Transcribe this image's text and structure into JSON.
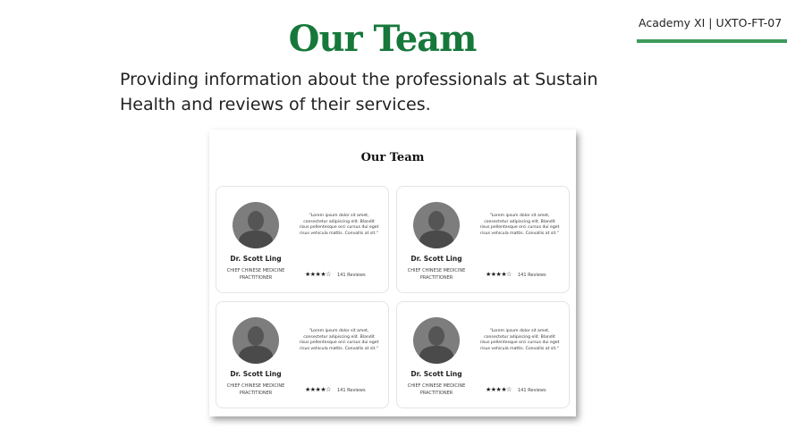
{
  "header": {
    "corner_label": "Academy XI | UXTO-FT-07",
    "accent_color": "#3d9a5b",
    "title": "Our Team",
    "title_color": "#16783a",
    "subtitle": "Providing information about the professionals at Sustain Health and reviews of their services."
  },
  "mockup": {
    "title": "Our Team",
    "cards": [
      {
        "name": "Dr. Scott Ling",
        "role": "CHIEF CHINESE MEDICINE PRACTITIONER",
        "quote": "\"Lorem ipsum dolor sit amet, consectetur adipiscing elit. Blandit risus pellentesque orci cursus dui eget risus vehicula mattis. Convallis at sit.\"",
        "rating": 4,
        "stars": "★★★★☆",
        "reviews": "141 Reviews"
      },
      {
        "name": "Dr. Scott Ling",
        "role": "CHIEF CHINESE MEDICINE PRACTITIONER",
        "quote": "\"Lorem ipsum dolor sit amet, consectetur adipiscing elit. Blandit risus pellentesque orci cursus dui eget risus vehicula mattis. Convallis at sit.\"",
        "rating": 4,
        "stars": "★★★★☆",
        "reviews": "141 Reviews"
      },
      {
        "name": "Dr. Scott Ling",
        "role": "CHIEF CHINESE MEDICINE PRACTITIONER",
        "quote": "\"Lorem ipsum dolor sit amet, consectetur adipiscing elit. Blandit risus pellentesque orci cursus dui eget risus vehicula mattis. Convallis at sit.\"",
        "rating": 4,
        "stars": "★★★★☆",
        "reviews": "141 Reviews"
      },
      {
        "name": "Dr. Scott Ling",
        "role": "CHIEF CHINESE MEDICINE PRACTITIONER",
        "quote": "\"Lorem ipsum dolor sit amet, consectetur adipiscing elit. Blandit risus pellentesque orci cursus dui eget risus vehicula mattis. Convallis at sit.\"",
        "rating": 4,
        "stars": "★★★★☆",
        "reviews": "141 Reviews"
      }
    ]
  }
}
